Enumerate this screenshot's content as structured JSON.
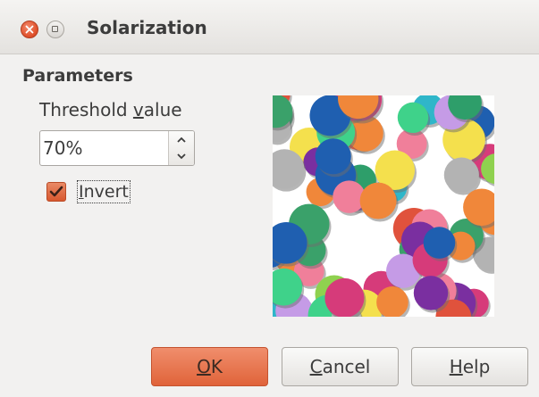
{
  "window": {
    "title": "Solarization"
  },
  "parameters": {
    "section_title": "Parameters",
    "threshold_label_pre": "Threshold ",
    "threshold_label_mnemonic": "v",
    "threshold_label_post": "alue",
    "threshold_value": "70%",
    "invert_checked": true,
    "invert_label_mnemonic": "I",
    "invert_label_post": "nvert"
  },
  "buttons": {
    "ok_mnemonic": "O",
    "ok_post": "K",
    "cancel_mnemonic": "C",
    "cancel_post": "ancel",
    "help_mnemonic": "H",
    "help_post": "elp"
  },
  "colors": {
    "accent": "#e0633a",
    "close_button": "#e0512c",
    "background": "#f2f1f0"
  },
  "icons": {
    "close": "close-icon",
    "maximize": "maximize-icon",
    "spin_up": "chevron-up-icon",
    "spin_down": "chevron-down-icon",
    "checkmark": "checkmark-icon"
  }
}
